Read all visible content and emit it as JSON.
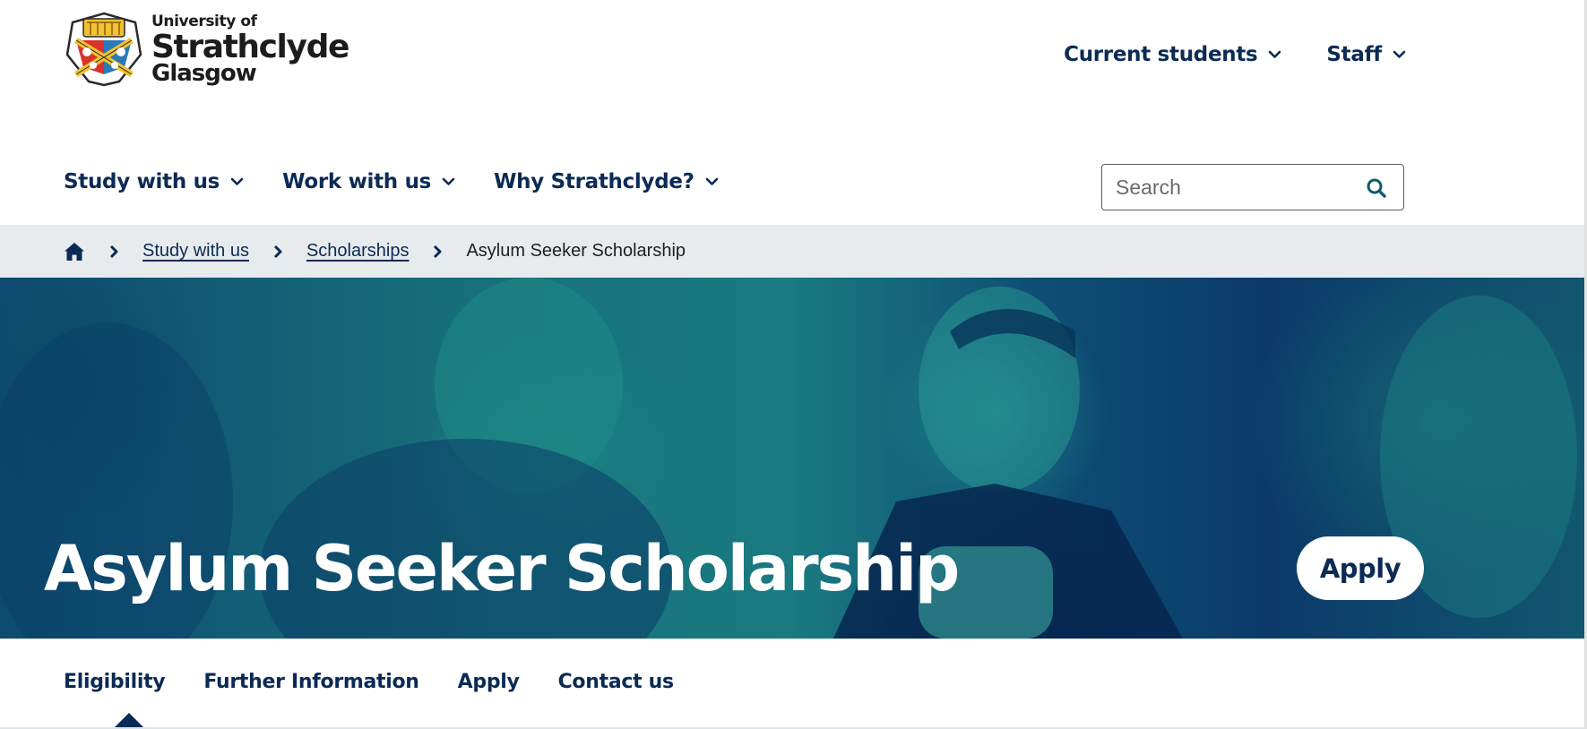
{
  "brand": {
    "line1": "University of",
    "line2": "Strathclyde",
    "line3": "Glasgow"
  },
  "utility_nav": [
    {
      "label": "Current students"
    },
    {
      "label": "Staff"
    }
  ],
  "main_nav": [
    {
      "label": "Study with us"
    },
    {
      "label": "Work with us"
    },
    {
      "label": "Why Strathclyde?"
    }
  ],
  "search": {
    "placeholder": "Search",
    "value": ""
  },
  "breadcrumb": {
    "items": [
      {
        "label": "Study with us"
      },
      {
        "label": "Scholarships"
      }
    ],
    "current": "Asylum Seeker Scholarship"
  },
  "hero": {
    "title": "Asylum Seeker Scholarship",
    "apply_label": "Apply"
  },
  "tabs": [
    {
      "label": "Eligibility",
      "active": true
    },
    {
      "label": "Further Information"
    },
    {
      "label": "Apply"
    },
    {
      "label": "Contact us"
    }
  ],
  "colors": {
    "navy": "#0b2a55",
    "teal": "#17707a",
    "breadcrumb_bg": "#e8ebed"
  },
  "icons": [
    "crest-logo",
    "chevron-down-icon",
    "search-icon",
    "home-icon",
    "chevron-right-icon"
  ]
}
